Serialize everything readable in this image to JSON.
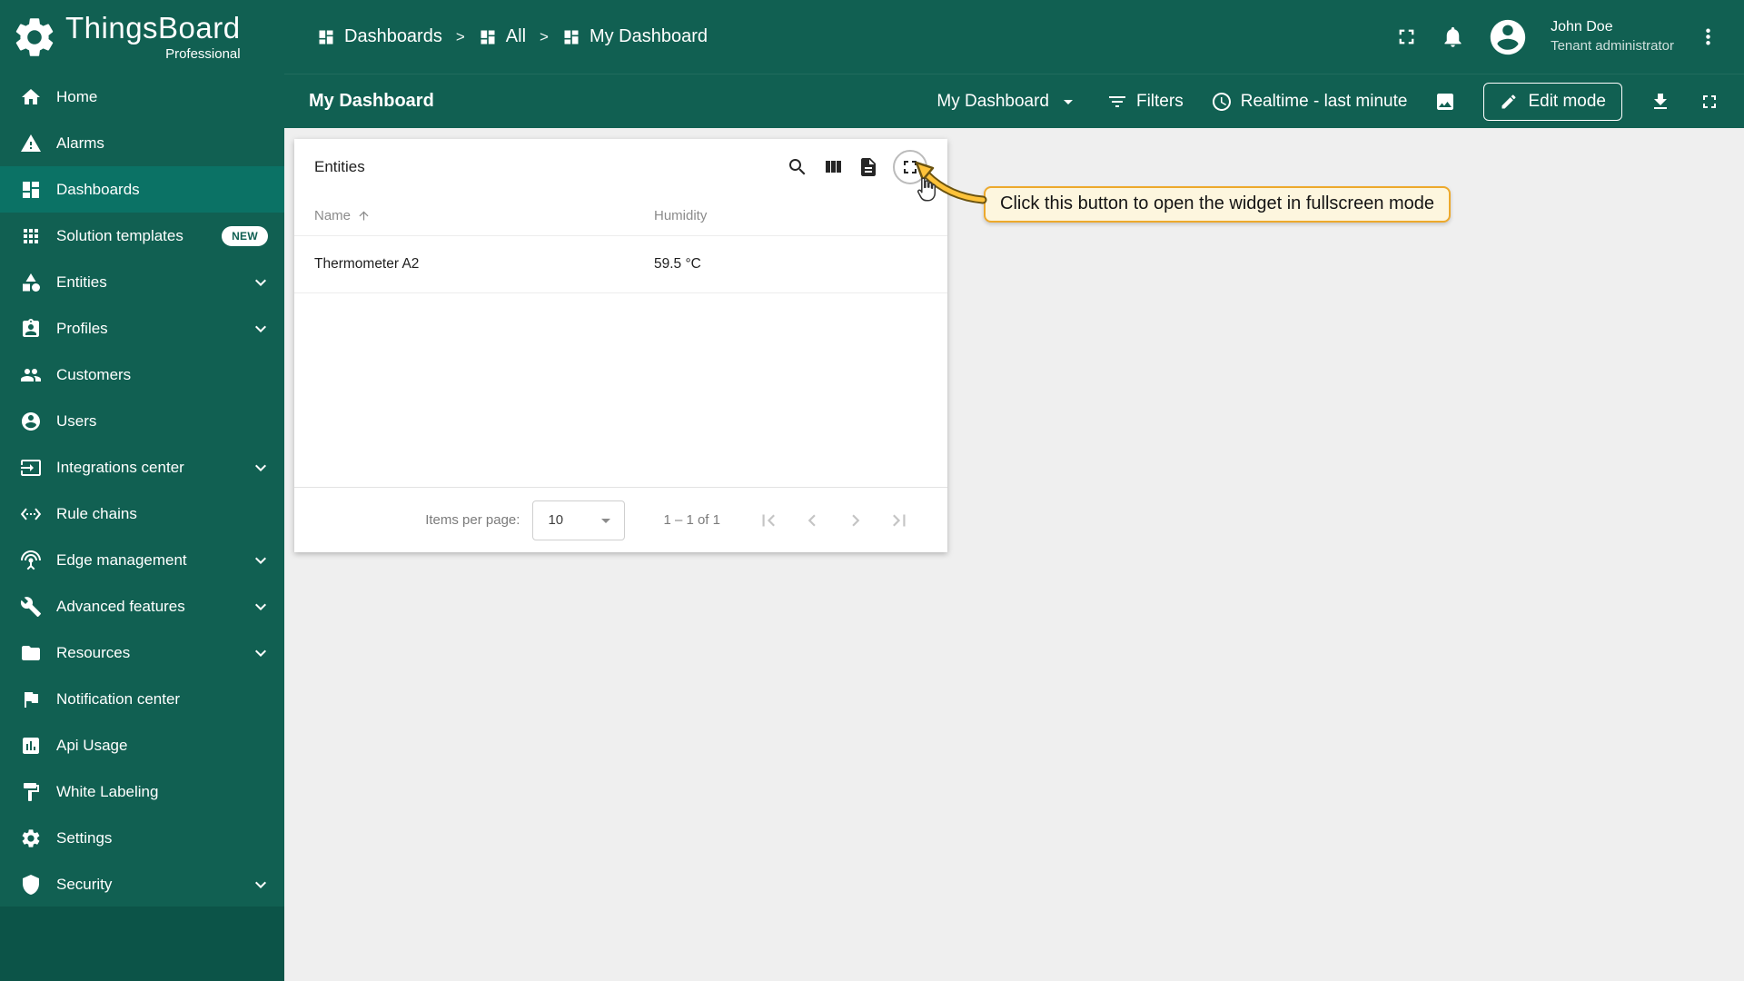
{
  "app": {
    "name": "ThingsBoard",
    "edition": "Professional"
  },
  "colors": {
    "primary": "#116052",
    "active_item": "#0b7265",
    "tooltip_bg": "#fdf6de",
    "tooltip_border": "#eda92c",
    "content_bg": "#efefef"
  },
  "sidebar": {
    "items": [
      {
        "label": "Home"
      },
      {
        "label": "Alarms"
      },
      {
        "label": "Dashboards",
        "active": true
      },
      {
        "label": "Solution templates",
        "badge": "NEW"
      },
      {
        "label": "Entities",
        "expandable": true
      },
      {
        "label": "Profiles",
        "expandable": true
      },
      {
        "label": "Customers"
      },
      {
        "label": "Users"
      },
      {
        "label": "Integrations center",
        "expandable": true
      },
      {
        "label": "Rule chains"
      },
      {
        "label": "Edge management",
        "expandable": true
      },
      {
        "label": "Advanced features",
        "expandable": true
      },
      {
        "label": "Resources",
        "expandable": true
      },
      {
        "label": "Notification center"
      },
      {
        "label": "Api Usage"
      },
      {
        "label": "White Labeling"
      },
      {
        "label": "Settings"
      },
      {
        "label": "Security",
        "expandable": true
      }
    ]
  },
  "header": {
    "breadcrumb": [
      {
        "label": "Dashboards"
      },
      {
        "label": "All"
      },
      {
        "label": "My Dashboard"
      }
    ],
    "separator": ">",
    "user": {
      "name": "John Doe",
      "role": "Tenant administrator"
    }
  },
  "toolbar": {
    "title": "My Dashboard",
    "dashboard_select": "My Dashboard",
    "filters_label": "Filters",
    "timewindow": "Realtime - last minute",
    "edit_mode_label": "Edit mode"
  },
  "widget": {
    "title": "Entities",
    "table": {
      "columns": [
        "Name",
        "Humidity"
      ],
      "rows": [
        [
          "Thermometer A2",
          "59.5 °C"
        ]
      ]
    },
    "pagination": {
      "items_per_page_label": "Items per page:",
      "page_size": "10",
      "range": "1 – 1 of 1"
    }
  },
  "tooltip": {
    "text": "Click this button to open the widget in fullscreen mode"
  }
}
